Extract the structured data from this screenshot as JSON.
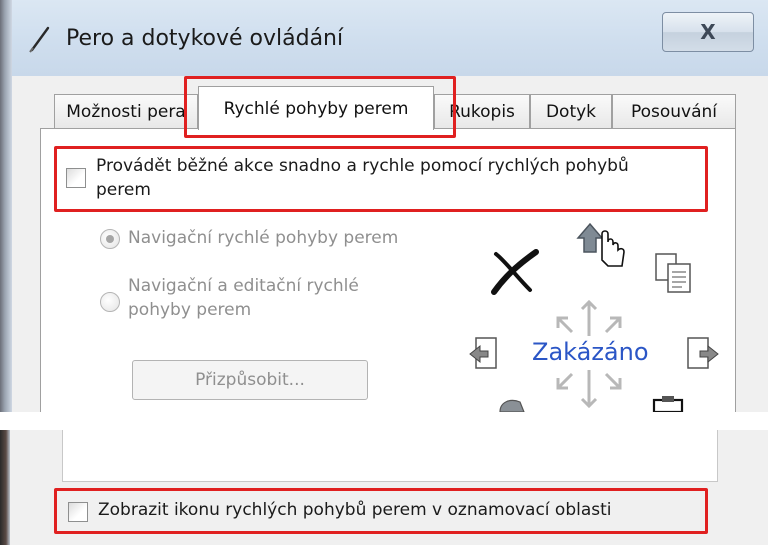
{
  "window": {
    "title": "Pero a dotykové ovládání",
    "close_label": "X"
  },
  "tabs": [
    {
      "label": "Možnosti pera",
      "active": false
    },
    {
      "label": "Rychlé pohyby perem",
      "active": true
    },
    {
      "label": "Rukopis",
      "active": false
    },
    {
      "label": "Dotyk",
      "active": false
    },
    {
      "label": "Posouvání",
      "active": false
    }
  ],
  "flicks": {
    "enable_checkbox_label_line1": "Provádět běžné akce snadno a rychle pomocí rychlých pohybů",
    "enable_checkbox_label_line2": "perem",
    "enable_checked": false,
    "radio_navigation": "Navigační rychlé pohyby perem",
    "radio_nav_edit_line1": "Navigační a editační rychlé",
    "radio_nav_edit_line2": "pohyby perem",
    "customize_button": "Přizpůsobit...",
    "center_status": "Zakázáno"
  },
  "notification": {
    "checkbox_label": "Zobrazit ikonu rychlých pohybů perem v oznamovací oblasti",
    "checked": false
  },
  "colors": {
    "highlight": "#e02020",
    "status_text": "#2b56c6",
    "disabled_text": "#8f8f8f"
  }
}
